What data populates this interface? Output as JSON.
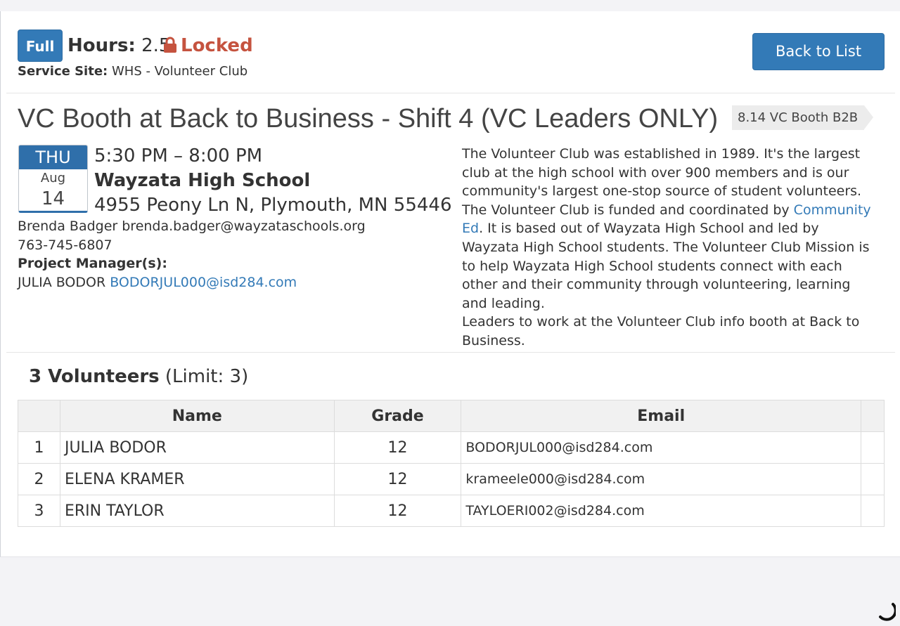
{
  "header": {
    "status_badge": "Full",
    "hours_label": "Hours:",
    "hours_value": "2.5",
    "locked_label": "Locked",
    "service_site_label": "Service Site:",
    "service_site_value": "WHS - Volunteer Club",
    "back_button": "Back to List"
  },
  "event": {
    "title": "VC Booth at Back to Business - Shift 4 (VC Leaders ONLY)",
    "tag": "8.14 VC Booth B2B",
    "date": {
      "dow": "THU",
      "month": "Aug",
      "day": "14"
    },
    "time": "5:30 PM – 8:00 PM",
    "location_name": "Wayzata High School",
    "address": "4955 Peony Ln N, Plymouth, MN 55446",
    "contact_name_email": "Brenda Badger brenda.badger@wayzataschools.org",
    "contact_phone": "763-745-6807",
    "pm_label": "Project Manager(s):",
    "pm_name": "JULIA BODOR",
    "pm_email": "BODORJUL000@isd284.com"
  },
  "description": {
    "part1": "The Volunteer Club was established in 1989. It's the largest club at the high school with over 900 members and is our community's largest one-stop source of student volunteers. The Volunteer Club is funded and coordinated by ",
    "link": "Community Ed",
    "part2": ". It is based out of Wayzata High School and led by Wayzata High School students. The Volunteer Club Mission is to help Wayzata High School students connect with each other and their community through volunteering, learning and leading.",
    "part3": "Leaders to work at the Volunteer Club info booth at Back to Business."
  },
  "volunteers": {
    "count_label": "3 Volunteers",
    "limit_label": "(Limit: 3)",
    "columns": [
      "",
      "Name",
      "Grade",
      "Email",
      ""
    ],
    "rows": [
      {
        "num": "1",
        "name": "JULIA BODOR",
        "grade": "12",
        "email": "BODORJUL000@isd284.com"
      },
      {
        "num": "2",
        "name": "ELENA KRAMER",
        "grade": "12",
        "email": "krameele000@isd284.com"
      },
      {
        "num": "3",
        "name": "ERIN TAYLOR",
        "grade": "12",
        "email": "TAYLOERI002@isd284.com"
      }
    ]
  },
  "colors": {
    "primary": "#337ab7",
    "locked": "#c5533f",
    "tag_bg": "#ececec"
  },
  "icons": {
    "lock": "lock-icon",
    "loading": "spinner-icon"
  }
}
